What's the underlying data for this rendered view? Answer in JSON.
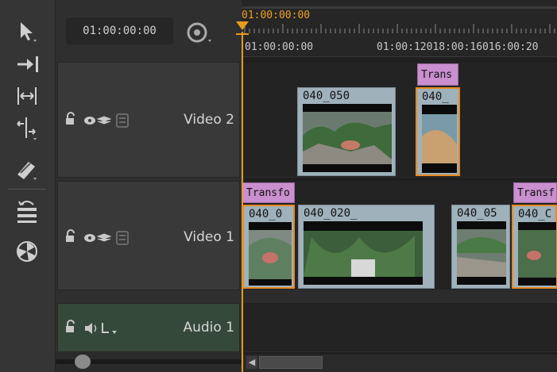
{
  "header": {
    "timecode": "01:00:00:00"
  },
  "ruler": {
    "playhead_timecode": "01:00:00:00",
    "start_label": "01:00:00:00",
    "tick_labels_text": "01:00:12018:00:16016:00:20"
  },
  "tracks": [
    {
      "name": "Video 2"
    },
    {
      "name": "Video 1"
    },
    {
      "name": "Audio 1"
    }
  ],
  "video2_clips": [
    {
      "name": "040_050"
    },
    {
      "name": "040_"
    }
  ],
  "video2_transition": "Trans",
  "video1_clips": [
    {
      "name": "040_0"
    },
    {
      "name": "040_020_"
    },
    {
      "name": "040_05"
    },
    {
      "name": "040_C"
    }
  ],
  "video1_transitions": [
    "Transfo",
    "Transf"
  ],
  "icons": {
    "tools": [
      "select-arrow-icon",
      "slip-clip-icon",
      "slide-clip-icon",
      "ripple-edit-icon",
      "razor-icon",
      "multi-track-select-icon",
      "render-icon"
    ],
    "track_header": [
      "lock-icon",
      "eye-icon",
      "layers-icon",
      "disk-icon"
    ],
    "audio_header": [
      "lock-icon",
      "speaker-icon",
      "channel-L-icon"
    ]
  },
  "colors": {
    "playhead": "#e89a20",
    "clip": "#9fb1bb",
    "transition": "#c98fce",
    "audio_track": "#34493a"
  }
}
